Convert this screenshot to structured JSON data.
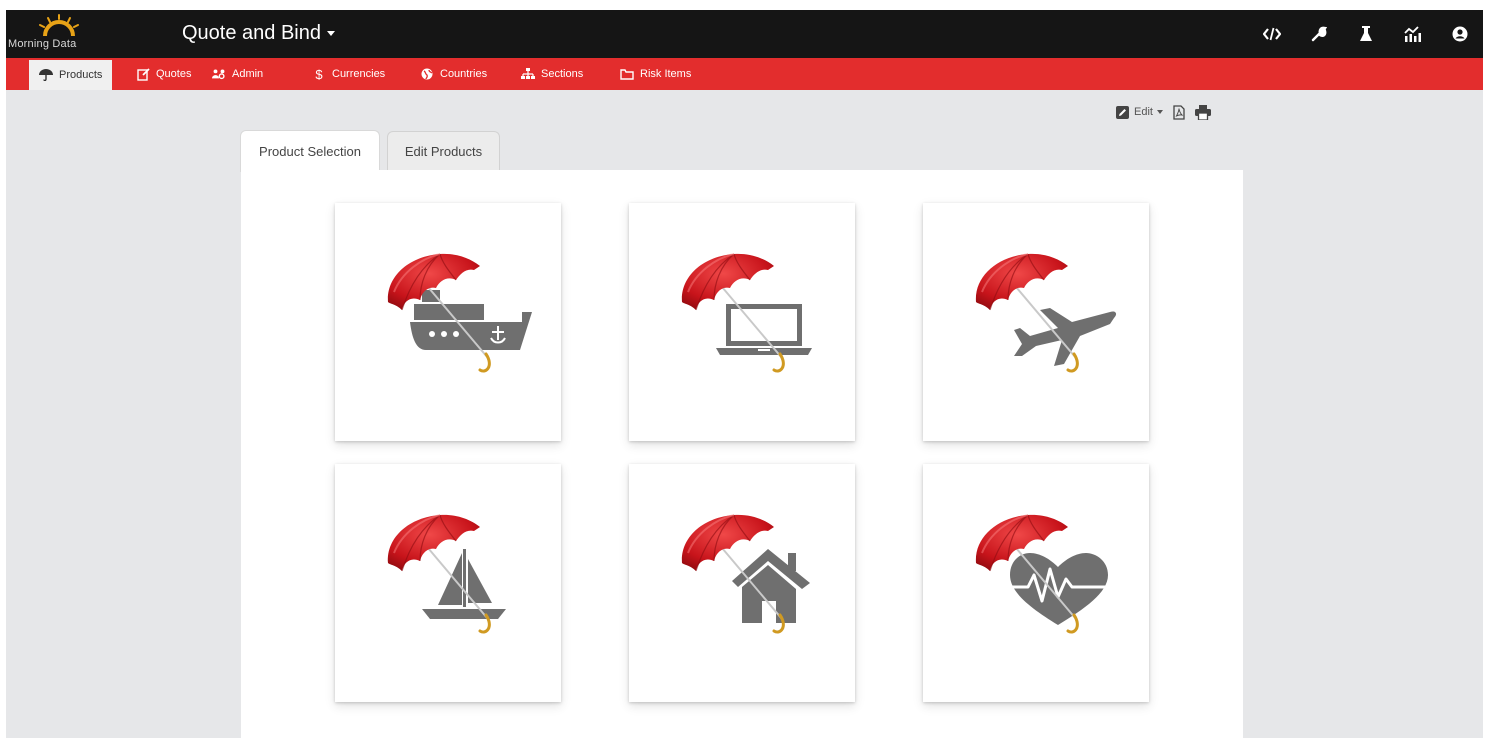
{
  "logo": {
    "text": "Morning Data"
  },
  "header": {
    "title": "Quote and Bind"
  },
  "top_icons": [
    "code-icon",
    "wrench-icon",
    "flask-icon",
    "chart-icon",
    "user-icon"
  ],
  "nav": {
    "items": [
      {
        "label": "Products",
        "icon": "umbrella-icon",
        "active": true
      },
      {
        "label": "Quotes",
        "icon": "edit-icon"
      },
      {
        "label": "Admin",
        "icon": "users-cog-icon"
      },
      {
        "label": "Currencies",
        "icon": "dollar-icon"
      },
      {
        "label": "Countries",
        "icon": "globe-icon"
      },
      {
        "label": "Sections",
        "icon": "sitemap-icon"
      },
      {
        "label": "Risk Items",
        "icon": "folder-icon"
      }
    ]
  },
  "toolbar": {
    "edit_label": "Edit"
  },
  "tabs": [
    {
      "label": "Product Selection",
      "active": true
    },
    {
      "label": "Edit Products",
      "active": false
    }
  ],
  "products": [
    {
      "icon": "umbrella-ship-icon"
    },
    {
      "icon": "umbrella-laptop-icon"
    },
    {
      "icon": "umbrella-airplane-icon"
    },
    {
      "icon": "umbrella-sailboat-icon"
    },
    {
      "icon": "umbrella-house-icon"
    },
    {
      "icon": "umbrella-heart-icon"
    }
  ],
  "colors": {
    "nav_red": "#e32d2d",
    "topbar": "#151515",
    "umbrella_red": "#c8141b",
    "icon_gray": "#6f6f6f"
  }
}
